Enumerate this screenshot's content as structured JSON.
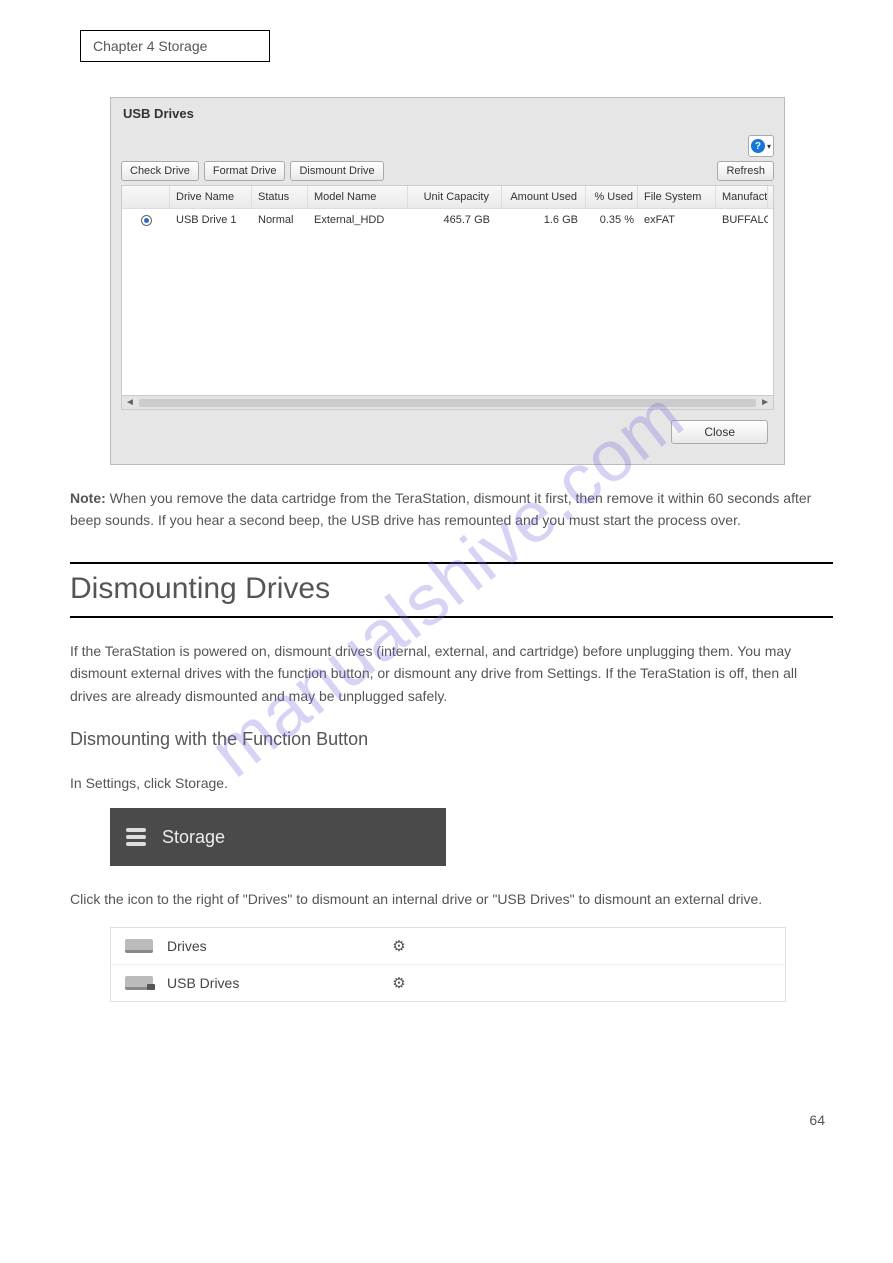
{
  "chapter_label": "Chapter 4 Storage",
  "dialog": {
    "title": "USB Drives",
    "buttons": {
      "check": "Check Drive",
      "format": "Format Drive",
      "dismount": "Dismount Drive",
      "refresh": "Refresh",
      "close": "Close"
    },
    "columns": [
      "",
      "Drive Name",
      "Status",
      "Model Name",
      "Unit Capacity",
      "Amount Used",
      "% Used",
      "File System",
      "Manufact"
    ],
    "rows": [
      {
        "selected": true,
        "drive_name": "USB Drive 1",
        "status": "Normal",
        "model_name": "External_HDD",
        "unit_capacity": "465.7 GB",
        "amount_used": "1.6 GB",
        "pct_used": "0.35 %",
        "file_system": "exFAT",
        "manufacturer": "BUFFALO"
      }
    ]
  },
  "note_label": "Note:",
  "note_text": " When you remove the data cartridge from the TeraStation, dismount it first, then remove it within 60 seconds after beep sounds. If you hear a second beep, the USB drive has remounted and you must start the process over.",
  "heading": "Dismounting Drives",
  "paragraph": "If the TeraStation is powered on, dismount drives (internal, external, and cartridge) before unplugging them. You may dismount external drives with the function button, or dismount any drive from Settings. If the TeraStation is off, then all drives are already dismounted and may be unplugged safely.",
  "subheading": "Dismounting with the Function Button",
  "storage_label": "Storage",
  "storage_step": "In Settings, click Storage.",
  "settings_rows": [
    {
      "label": "Drives",
      "icon": "drive"
    },
    {
      "label": "USB Drives",
      "icon": "usb"
    }
  ],
  "settings_step": "Click the     icon to the right of \"Drives\" to dismount an internal drive or \"USB Drives\" to dismount an external drive.",
  "watermark": "manualshive.com",
  "page_number": "64",
  "help_q": "?",
  "gear_glyph": "⚙"
}
